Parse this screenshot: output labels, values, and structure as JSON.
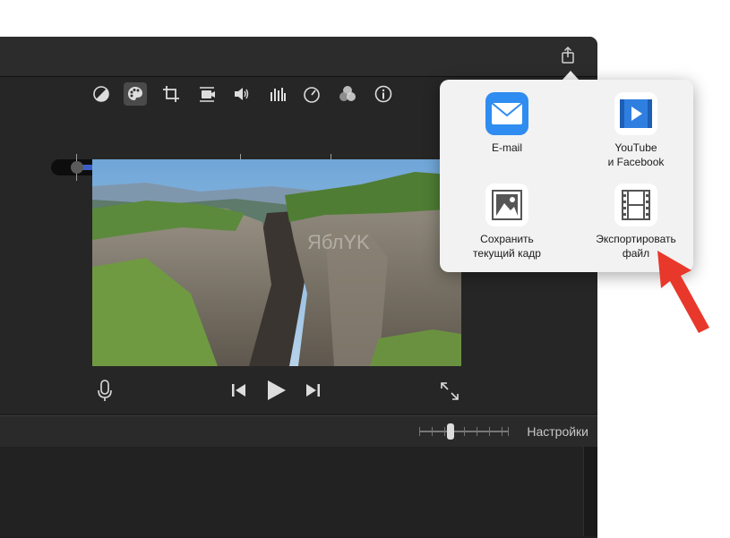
{
  "toolbar": {
    "icons": [
      "color-balance-icon",
      "palette-icon",
      "crop-icon",
      "stabilization-icon",
      "volume-icon",
      "equalizer-icon",
      "speed-icon",
      "filter-icon",
      "info-icon"
    ]
  },
  "playback": {
    "icons": [
      "microphone-icon",
      "skip-back-icon",
      "play-icon",
      "skip-forward-icon",
      "fullscreen-icon"
    ]
  },
  "timeline": {
    "settings_label": "Настройки"
  },
  "share_menu": {
    "items": [
      {
        "label": "E-mail",
        "icon": "mail-icon",
        "color": "#2f8cf0"
      },
      {
        "label": "YouTube\nи Facebook",
        "icon": "video-icon",
        "color": "#2f7fe0"
      },
      {
        "label": "Сохранить\nтекущий кадр",
        "icon": "image-icon",
        "color": "#555555"
      },
      {
        "label": "Экспортировать\nфайл",
        "icon": "film-icon",
        "color": "#555555"
      }
    ]
  },
  "watermark": "ЯблYK",
  "colors": {
    "accent_red": "#e8382b",
    "window_bg": "#1f1f1f",
    "popover_bg": "#f2f2f2"
  }
}
